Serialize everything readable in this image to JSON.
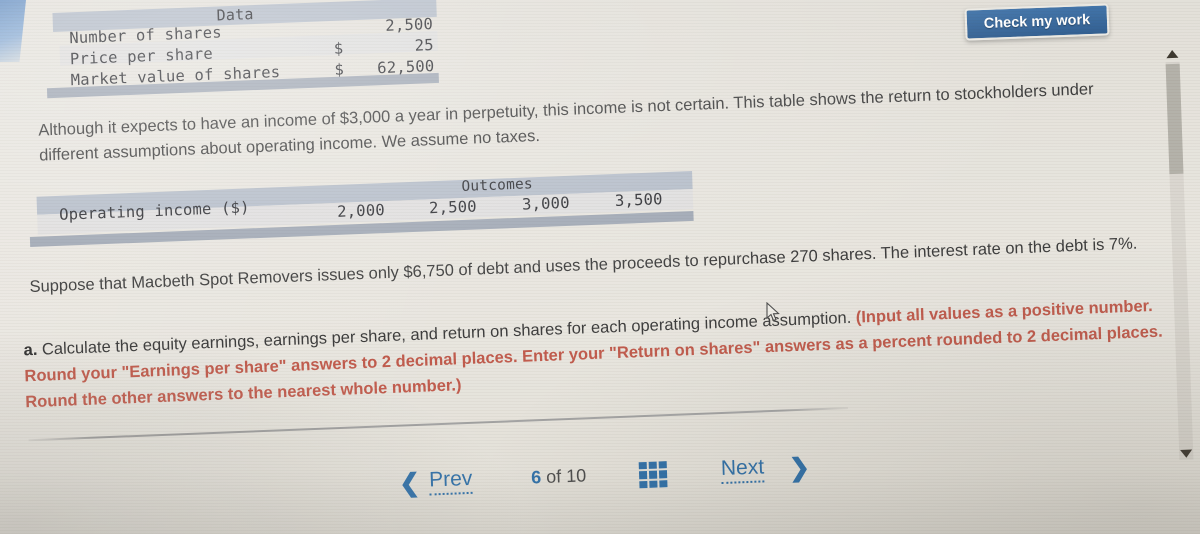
{
  "check_button": {
    "label": "Check my work"
  },
  "data_table": {
    "header": "Data",
    "rows": [
      {
        "label": "Number of shares",
        "currency": "",
        "value": "2,500"
      },
      {
        "label": "Price per share",
        "currency": "$",
        "value": "25"
      },
      {
        "label": "Market value of shares",
        "currency": "$",
        "value": "62,500"
      }
    ]
  },
  "paragraph_1": "Although it expects to have an income of $3,000 a year in perpetuity, this income is not certain. This table shows the return to stockholders under different assumptions about operating income. We assume no taxes.",
  "outcomes_table": {
    "header": "Outcomes",
    "row_label": "Operating income ($)",
    "values": [
      "2,000",
      "2,500",
      "3,000",
      "3,500"
    ]
  },
  "paragraph_2": "Suppose that Macbeth Spot Removers issues only $6,750 of debt and uses the proceeds to repurchase 270 shares. The interest rate on the debt is 7%.",
  "part_a": {
    "marker": "a.",
    "question": " Calculate the equity earnings, earnings per share, and return on shares for each operating income assumption. ",
    "instruction": "(Input all values as a positive number. Round your \"Earnings per share\" answers to 2 decimal places. Enter your \"Return on shares\" answers as a percent rounded to 2 decimal places. Round the other answers to the nearest whole number.)"
  },
  "footer": {
    "prev_label": "Prev",
    "next_label": "Next",
    "current_page": "6",
    "of_label": "of",
    "total_pages": "10",
    "grid_icon": "grid-icon"
  },
  "colors": {
    "accent_blue": "#2e6ea6",
    "button_blue": "#3f72a8",
    "instruction_red": "#c0594a",
    "table_band": "#b5bdc9"
  }
}
